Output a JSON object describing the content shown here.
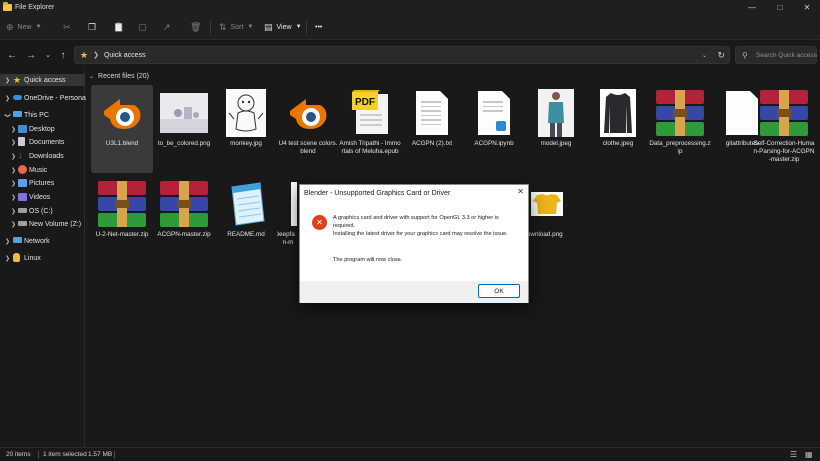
{
  "window": {
    "title": "File Explorer"
  },
  "toolbar": {
    "new_label": "New",
    "sort_label": "Sort",
    "view_label": "View",
    "more_label": "•••"
  },
  "address": {
    "location": "Quick access",
    "search_placeholder": "Search Quick access"
  },
  "sidebar": {
    "items": [
      {
        "label": "Quick access",
        "color": "#f0c23a"
      },
      {
        "label": "OneDrive - Personal",
        "color": "#3a8fe0"
      },
      {
        "label": "This PC",
        "color": "#4da3e8"
      },
      {
        "label": "Desktop",
        "color": "#3f8fd6"
      },
      {
        "label": "Documents",
        "color": "#9aa0a6"
      },
      {
        "label": "Downloads",
        "color": "#2fa36b"
      },
      {
        "label": "Music",
        "color": "#e46a4a"
      },
      {
        "label": "Pictures",
        "color": "#5aa0e6"
      },
      {
        "label": "Videos",
        "color": "#8a6fe0"
      },
      {
        "label": "OS (C:)",
        "color": "#9aa0a6"
      },
      {
        "label": "New Volume (Z:)",
        "color": "#9aa0a6"
      },
      {
        "label": "Network",
        "color": "#4da3e8"
      },
      {
        "label": "Linux",
        "color": "#e8c03a"
      }
    ]
  },
  "content": {
    "section_title": "Recent files (20)",
    "files_row1": [
      {
        "label": "U3L1.blend",
        "kind": "blender"
      },
      {
        "label": "to_be_colored.png",
        "kind": "image-sketch"
      },
      {
        "label": "monkey.jpg",
        "kind": "image-monkey"
      },
      {
        "label": "U4 test scene colors.blend",
        "kind": "blender"
      },
      {
        "label": "Amish Tripathi - Immortals of Meluha.epub",
        "kind": "pdf"
      },
      {
        "label": "ACGPN (2).txt",
        "kind": "doc"
      },
      {
        "label": "ACGPN.ipynb",
        "kind": "doc-code"
      },
      {
        "label": "model.jpeg",
        "kind": "photo-model"
      },
      {
        "label": "clothe.jpeg",
        "kind": "photo-clothe"
      },
      {
        "label": "Data_preprocessing.zip",
        "kind": "rar"
      },
      {
        "label": "gitattributes",
        "kind": "doc-blank"
      },
      {
        "label": "Self-Correction-Human-Parsing-for-ACGPN-master.zip",
        "kind": "rar"
      }
    ],
    "files_row2": [
      {
        "label": "U-2-Net-master.zip",
        "kind": "rar"
      },
      {
        "label": "ACGPN-master.zip",
        "kind": "rar"
      },
      {
        "label": "README.md",
        "kind": "notepad"
      },
      {
        "label": "Deepfa On-m",
        "kind": "doc-partial"
      },
      {
        "label": "download.png",
        "kind": "photo-tshirt"
      }
    ]
  },
  "dialog": {
    "title": "Blender - Unsupported Graphics Card or Driver",
    "line1": "A graphics card and driver with support for OpenGL 3.3 or higher is required.",
    "line2": "Installing the latest driver for your graphics card may resolve the issue.",
    "line3": "The program will now close.",
    "ok_label": "OK"
  },
  "status": {
    "item_count": "20 items",
    "selection": "1 item selected",
    "size": "1.57 MB"
  }
}
